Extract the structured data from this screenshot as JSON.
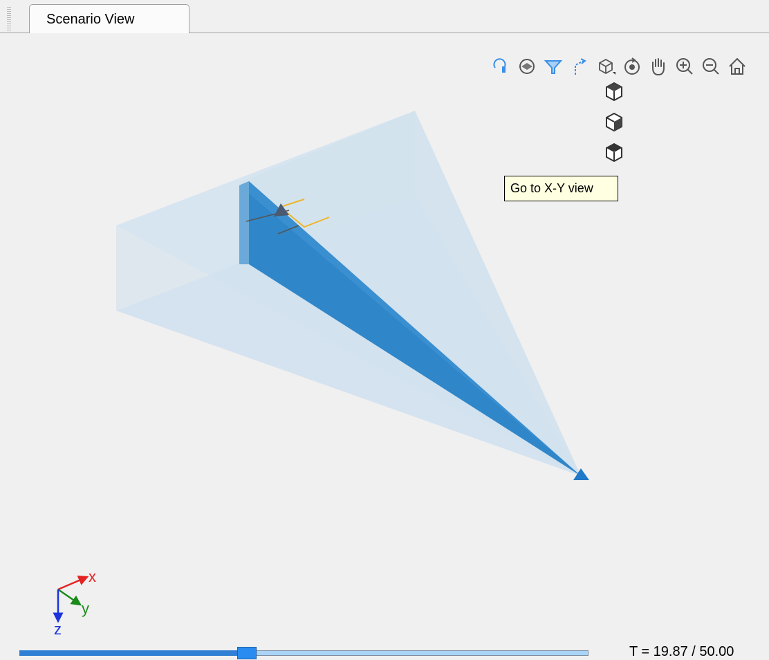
{
  "tab": {
    "label": "Scenario View"
  },
  "toolbar": {
    "buttons": [
      {
        "icon": "route-icon",
        "color": "#3a8fe8"
      },
      {
        "icon": "layers-icon",
        "color": "#555555"
      },
      {
        "icon": "coverage-icon",
        "color": "#3a8fe8"
      },
      {
        "icon": "trajectory-icon",
        "color": "#3a8fe8"
      },
      {
        "icon": "view-cube-icon",
        "color": "#555555"
      },
      {
        "icon": "rotate-icon",
        "color": "#555555"
      },
      {
        "icon": "pan-icon",
        "color": "#555555"
      },
      {
        "icon": "zoom-in-icon",
        "color": "#555555"
      },
      {
        "icon": "zoom-out-icon",
        "color": "#555555"
      },
      {
        "icon": "home-icon",
        "color": "#555555"
      }
    ]
  },
  "view_menu": {
    "items": [
      {
        "icon": "view-cube-front-icon"
      },
      {
        "icon": "view-cube-side-icon"
      },
      {
        "icon": "view-cube-top-icon"
      }
    ]
  },
  "tooltip": {
    "text": "Go to X-Y view"
  },
  "axes_indicator": {
    "x": "x",
    "y": "y",
    "z": "z"
  },
  "timeline": {
    "current": 19.87,
    "end": 50.0,
    "fraction": 0.3974,
    "label": "T = 19.87 / 50.00"
  },
  "colors": {
    "coverage": "#c9dff0",
    "beam": "#2f86c9",
    "platform": "#1f78c8",
    "target": "#f0b429",
    "axis_x": "#e52222",
    "axis_y": "#1a8a1a",
    "axis_z": "#1a33dd"
  }
}
